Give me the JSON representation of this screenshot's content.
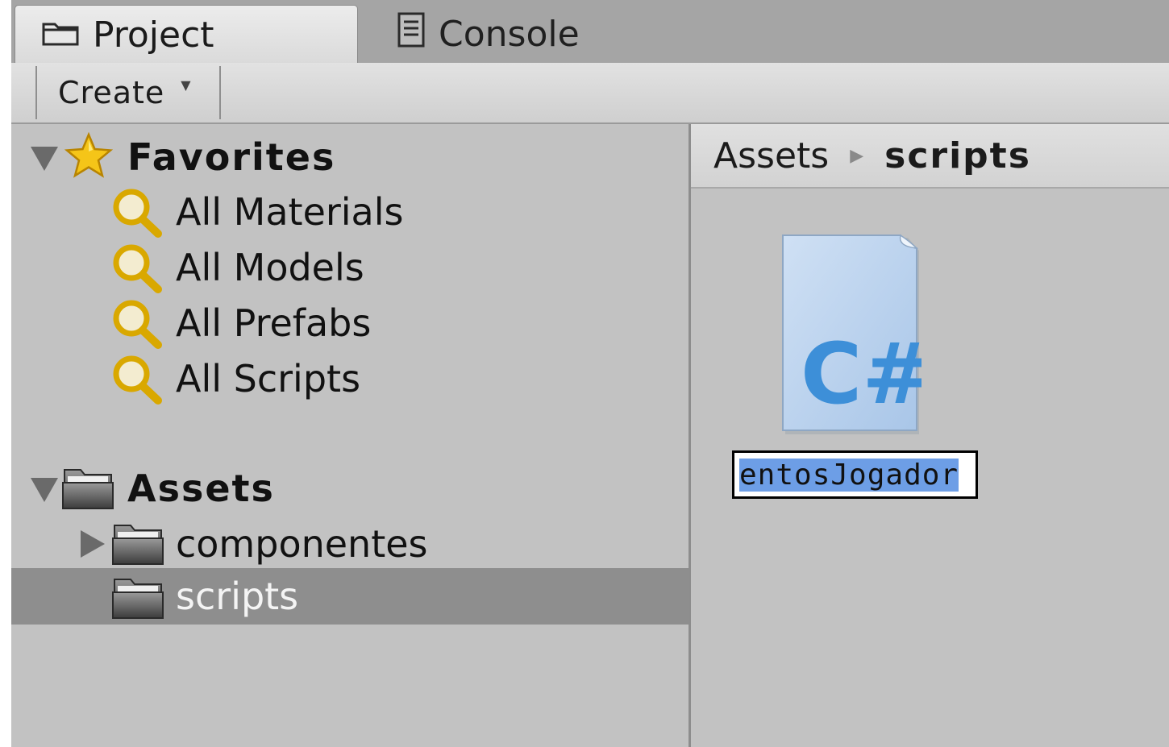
{
  "tabs": {
    "project_label": "Project",
    "console_label": "Console"
  },
  "toolbar": {
    "create_label": "Create"
  },
  "favorites": {
    "header": "Favorites",
    "items": [
      {
        "label": "All Materials",
        "icon": "search-icon"
      },
      {
        "label": "All Models",
        "icon": "search-icon"
      },
      {
        "label": "All Prefabs",
        "icon": "search-icon"
      },
      {
        "label": "All Scripts",
        "icon": "search-icon"
      }
    ]
  },
  "assets_tree": {
    "header": "Assets",
    "folders": [
      {
        "label": "componentes",
        "expandable": true,
        "selected": false
      },
      {
        "label": "scripts",
        "expandable": false,
        "selected": true
      }
    ]
  },
  "breadcrumb": {
    "root": "Assets",
    "current": "scripts"
  },
  "asset": {
    "icon_text": "C#",
    "rename_value": "entosJogador"
  },
  "colors": {
    "panel_bg": "#c2c2c2",
    "selection_row": "#8e8e8e",
    "rename_highlight": "#6d9ee6",
    "csharp_blue": "#3d8fd8"
  }
}
